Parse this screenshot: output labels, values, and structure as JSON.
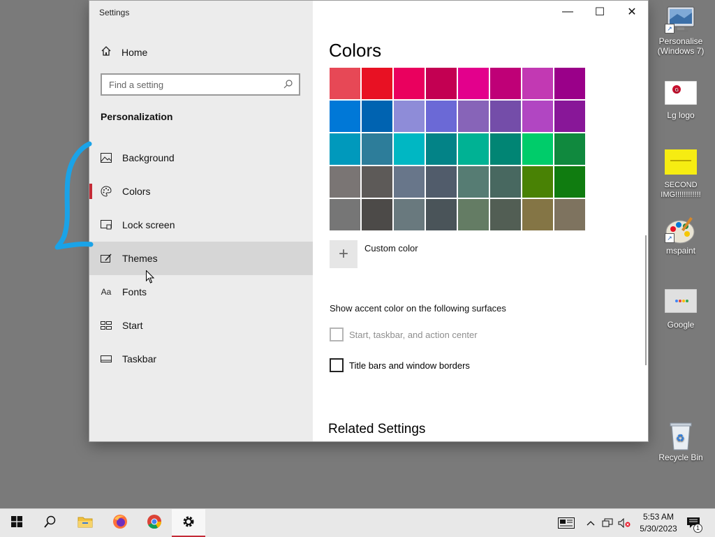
{
  "window": {
    "title": "Settings",
    "controls": {
      "minimize": "—",
      "maximize": "☐",
      "close": "✕"
    }
  },
  "sidebar": {
    "home_label": "Home",
    "search_placeholder": "Find a setting",
    "section_title": "Personalization",
    "items": [
      {
        "label": "Background",
        "icon": "image-icon"
      },
      {
        "label": "Colors",
        "icon": "palette-icon"
      },
      {
        "label": "Lock screen",
        "icon": "lock-screen-icon"
      },
      {
        "label": "Themes",
        "icon": "themes-icon"
      },
      {
        "label": "Fonts",
        "icon": "fonts-icon"
      },
      {
        "label": "Start",
        "icon": "start-icon"
      },
      {
        "label": "Taskbar",
        "icon": "taskbar-icon"
      }
    ],
    "active_item": "Colors",
    "hover_item": "Themes"
  },
  "content": {
    "title": "Colors",
    "swatches": [
      [
        "#e74856",
        "#e81123",
        "#ea005e",
        "#c30052",
        "#e3008c",
        "#bf0077",
        "#c239b3",
        "#9a0089"
      ],
      [
        "#0078d7",
        "#0063b1",
        "#8e8cd8",
        "#6b69d6",
        "#8764b8",
        "#744da9",
        "#b146c2",
        "#881798"
      ],
      [
        "#0099bc",
        "#2d7d9a",
        "#00b7c3",
        "#038387",
        "#00b294",
        "#018574",
        "#00cc6a",
        "#10893e"
      ],
      [
        "#7a7574",
        "#5d5a58",
        "#68768a",
        "#515c6b",
        "#567c73",
        "#486860",
        "#498205",
        "#107c10"
      ],
      [
        "#767676",
        "#4c4a48",
        "#69797e",
        "#4a5459",
        "#647c64",
        "#525e54",
        "#847545",
        "#7e735f"
      ]
    ],
    "custom_color_label": "Custom color",
    "surfaces_label": "Show accent color on the following surfaces",
    "checkbox_start": "Start, taskbar, and action center",
    "checkbox_titlebars": "Title bars and window borders",
    "related_title": "Related Settings"
  },
  "desktop": {
    "icons": [
      {
        "label": "Personalise (Windows 7)"
      },
      {
        "label": "Lg logo"
      },
      {
        "label": "SECOND IMG!!!!!!!!!!!!"
      },
      {
        "label": "mspaint"
      },
      {
        "label": "Google"
      },
      {
        "label": "Recycle Bin"
      }
    ]
  },
  "taskbar": {
    "time": "5:53 AM",
    "date": "5/30/2023",
    "notification_count": "1"
  },
  "colors": {
    "accent": "#c42b37",
    "annotation": "#1aa3e8"
  }
}
